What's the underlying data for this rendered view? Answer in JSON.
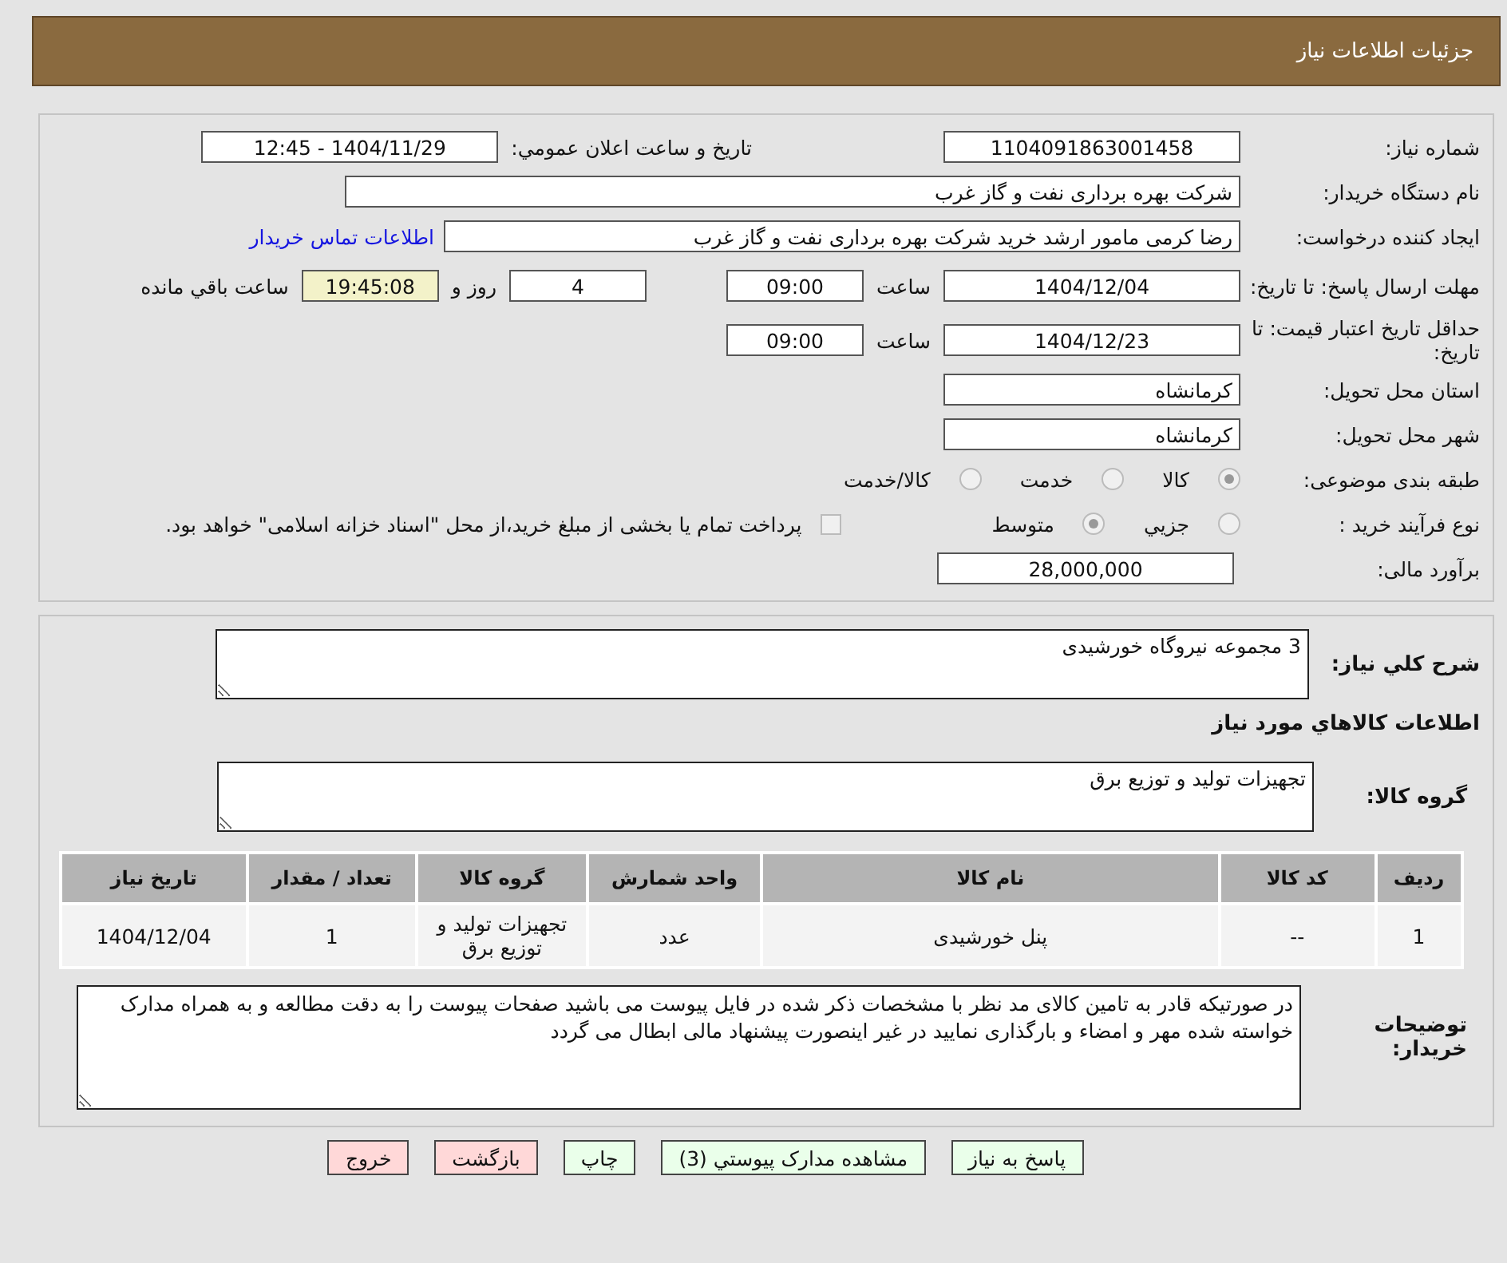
{
  "header": {
    "title": "جزئیات اطلاعات نیاز"
  },
  "need_number": {
    "label": "شماره نیاز:",
    "value": "1104091863001458"
  },
  "announce": {
    "label": "تاریخ و ساعت اعلان عمومي:",
    "value": "1404/11/29 - 12:45"
  },
  "buyer_org": {
    "label": "نام دستگاه خریدار:",
    "value": "شرکت بهره برداری نفت و گاز غرب"
  },
  "requester": {
    "label": "ایجاد کننده درخواست:",
    "value": "رضا کرمی مامور ارشد خرید شرکت بهره برداری نفت و گاز غرب",
    "link": "اطلاعات تماس خریدار"
  },
  "deadline": {
    "label": "مهلت ارسال پاسخ: تا تاریخ:",
    "date": "1404/12/04",
    "time_label": "ساعت",
    "time": "09:00",
    "days": "4",
    "days_label": "روز و",
    "remaining": "19:45:08",
    "remaining_label": "ساعت باقي مانده"
  },
  "validity": {
    "label": "حداقل تاریخ اعتبار قیمت: تا تاریخ:",
    "date": "1404/12/23",
    "time_label": "ساعت",
    "time": "09:00"
  },
  "province": {
    "label": "استان محل تحویل:",
    "value": "کرمانشاه"
  },
  "city": {
    "label": "شهر محل تحویل:",
    "value": "کرمانشاه"
  },
  "category": {
    "label": "طبقه بندی موضوعی:",
    "options": [
      {
        "label": "کالا",
        "selected": true
      },
      {
        "label": "خدمت",
        "selected": false
      },
      {
        "label": "کالا/خدمت",
        "selected": false
      }
    ]
  },
  "process": {
    "label": "نوع فرآیند خرید :",
    "options": [
      {
        "label": "جزيي",
        "selected": false
      },
      {
        "label": "متوسط",
        "selected": true
      }
    ],
    "checkbox": {
      "label": "پرداخت تمام یا بخشی از مبلغ خرید،از محل \"اسناد خزانه اسلامی\" خواهد بود.",
      "checked": false
    }
  },
  "estimate": {
    "label": "برآورد مالی:",
    "value": "28,000,000"
  },
  "description": {
    "label": "شرح كلي نياز:",
    "value": "3 مجموعه نیروگاه خورشیدی"
  },
  "goods_heading": "اطلاعات كالاهاي مورد نياز",
  "goods_group": {
    "label": "گروه کالا:",
    "value": "تجهیزات تولید و توزیع برق"
  },
  "table": {
    "columns": [
      "ردیف",
      "کد کالا",
      "نام کالا",
      "واحد شمارش",
      "گروه کالا",
      "تعداد / مقدار",
      "تاریخ نیاز"
    ],
    "rows": [
      [
        "1",
        "--",
        "پنل خورشیدی",
        "عدد",
        "تجهیزات تولید و توزیع برق",
        "1",
        "1404/12/04"
      ]
    ]
  },
  "buyer_notes": {
    "label": "توضیحات خریدار:",
    "value": "در صورتیکه قادر به تامین کالای مد نظر با مشخصات ذکر شده در فایل پیوست می باشید صفحات پیوست را به دقت مطالعه و به همراه مدارک خواسته شده مهر و امضاء و بارگذاری نمایید در غیر اینصورت پیشنهاد مالی ابطال می گردد"
  },
  "buttons": [
    {
      "label": "پاسخ به نیاز",
      "kind": "action"
    },
    {
      "label": "مشاهده مدارک پیوستي (3)",
      "kind": "action"
    },
    {
      "label": "چاپ",
      "kind": "action"
    },
    {
      "label": "بازگشت",
      "kind": "exit"
    },
    {
      "label": "خروج",
      "kind": "exit"
    }
  ]
}
